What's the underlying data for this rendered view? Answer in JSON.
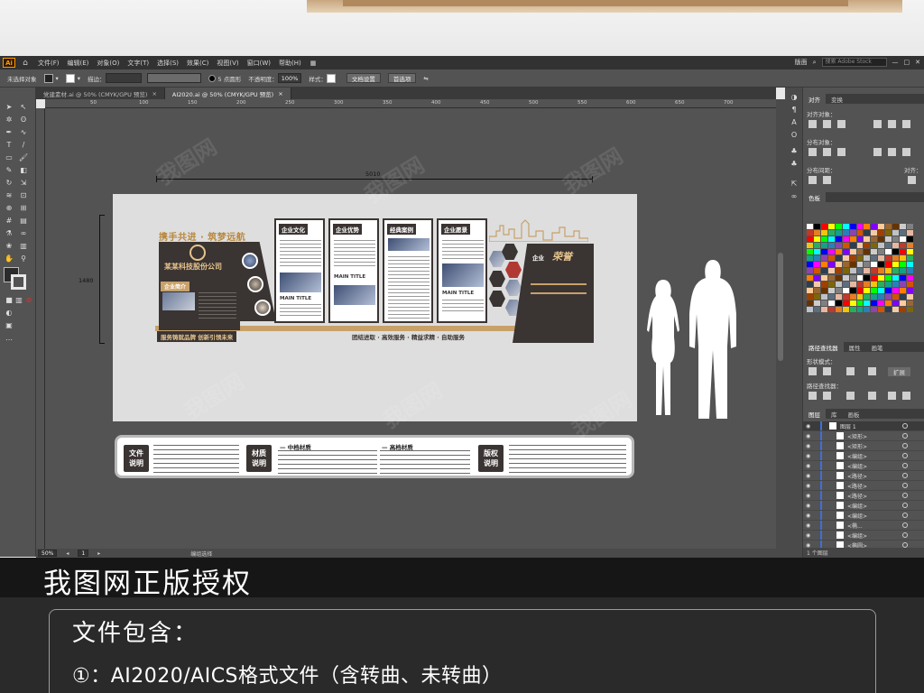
{
  "app": {
    "logo_text": "Ai"
  },
  "menu": [
    "文件(F)",
    "编辑(E)",
    "对象(O)",
    "文字(T)",
    "选择(S)",
    "效果(C)",
    "视图(V)",
    "窗口(W)",
    "帮助(H)"
  ],
  "menu_right": {
    "workspace": "版面",
    "search_placeholder": "搜索 Adobe Stock"
  },
  "control": {
    "selection": "未选择对象",
    "stroke_label": "描边：",
    "brush_label": "5 点圆形",
    "opacity_label": "不透明度：",
    "opacity_value": "100%",
    "style_label": "样式：",
    "doc_setup": "文档设置",
    "preferences": "首选项"
  },
  "tabs": [
    {
      "label": "党建素材.ai @ 50% (CMYK/GPU 预览)",
      "close": "×"
    },
    {
      "label": "AI2020.ai @ 50% (CMYK/GPU 预览)",
      "close": "×"
    }
  ],
  "ruler_top": [
    "50",
    "100",
    "150",
    "200",
    "250",
    "300",
    "350",
    "400",
    "450",
    "500",
    "550",
    "600",
    "650",
    "700"
  ],
  "status": {
    "zoom": "50%",
    "artboard": "1",
    "label": "编组选择"
  },
  "artwork": {
    "width_dim": "5010",
    "height_dim": "1480",
    "slogan": "携手共进 · 筑梦远航",
    "company": "某某科技股份公司",
    "intro": "企业简介",
    "bottom_slogan": "服务铸就品牌  创新引领未来",
    "bottom_slogan2": "团结进取 · 高效服务 · 精益求精 · 自助服务",
    "panels": [
      {
        "title": "企业文化",
        "main": "MAIN TITLE"
      },
      {
        "title": "企业优势",
        "main": "MAIN TITLE"
      },
      {
        "title": "经典案例",
        "main": ""
      },
      {
        "title": "企业愿景",
        "main": "MAIN TITLE"
      }
    ],
    "honor_prefix": "企业",
    "honor": "荣誉"
  },
  "description": {
    "tag1": "文件\n说明",
    "tag2": "材质\n说明",
    "sub1": "— 中档材质",
    "sub2": "— 高档材质",
    "tag3": "版权\n说明"
  },
  "right_panels": {
    "tabs_top": [
      "对齐",
      "变换"
    ],
    "align_objects": "对齐对象：",
    "distribute_objects": "分布对象：",
    "distribute_spacing": "分布间距：",
    "align_to": "对齐：",
    "swatches_tab": "色板",
    "pathfinder_tabs": [
      "路径查找器",
      "属性",
      "画笔"
    ],
    "shape_modes": "形状模式：",
    "pathfinders": "路径查找器：",
    "expand": "扩展",
    "layers_tabs": [
      "图层",
      "库",
      "画板"
    ],
    "layers": [
      "图层 1",
      "<矩形>",
      "<矩形>",
      "<编组>",
      "<编组>",
      "<路径>",
      "<路径>",
      "<路径>",
      "<编组>",
      "<编组>",
      "<椭...",
      "<编组>",
      "<椭圆>"
    ],
    "layers_footer": "1 个图层"
  },
  "promo": {
    "title": "我图网正版授权",
    "heading": "文件包含：",
    "line1": "①：AI2020/AICS格式文件（含转曲、未转曲）"
  },
  "colors": {
    "ui_dark": "#535353",
    "ui_darker": "#323232",
    "accent_tan": "#c8a16a",
    "wall_dark": "#3a3432",
    "honor_gold": "#e6c48e"
  }
}
